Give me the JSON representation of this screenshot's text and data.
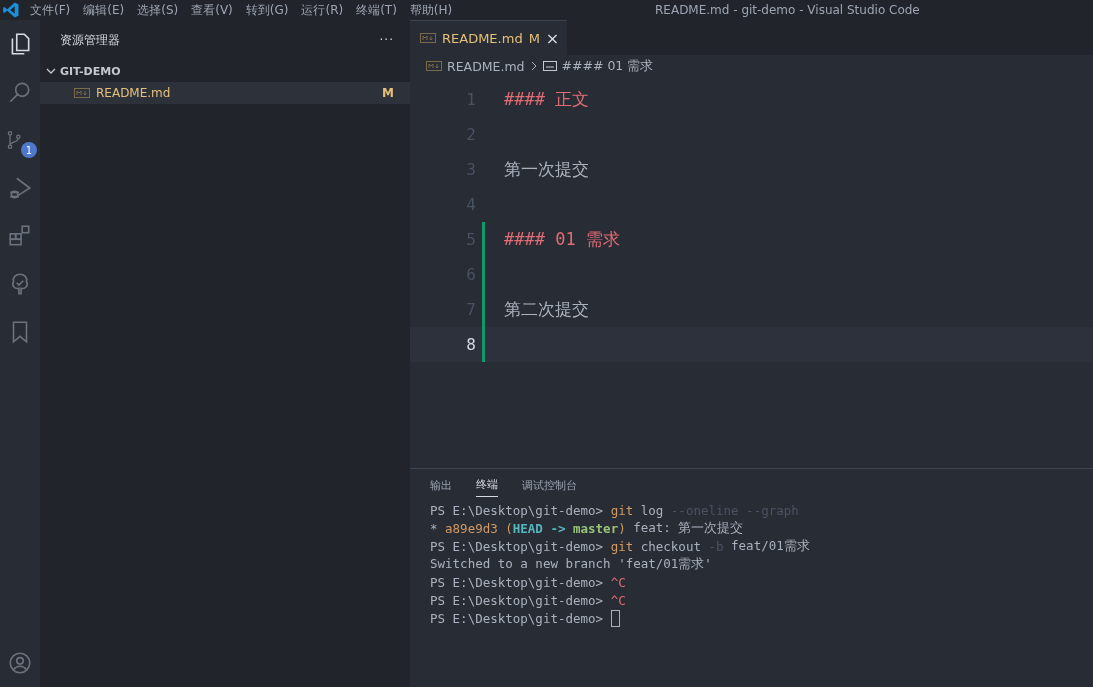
{
  "window": {
    "title": "README.md - git-demo - Visual Studio Code"
  },
  "menu": [
    "文件(F)",
    "编辑(E)",
    "选择(S)",
    "查看(V)",
    "转到(G)",
    "运行(R)",
    "终端(T)",
    "帮助(H)"
  ],
  "activity_bar": [
    {
      "kind": "files",
      "selected": true
    },
    {
      "kind": "search",
      "selected": false
    },
    {
      "kind": "scm",
      "selected": false,
      "badge": "1"
    },
    {
      "kind": "debug",
      "selected": false
    },
    {
      "kind": "extensions",
      "selected": false
    },
    {
      "kind": "tree",
      "selected": false
    },
    {
      "kind": "bookmark",
      "selected": false
    },
    {
      "kind": "account",
      "selected": false
    }
  ],
  "sidebar": {
    "title": "资源管理器",
    "more": "···",
    "folder": {
      "name": "GIT-DEMO",
      "expanded": true,
      "children": [
        {
          "name": "README.md",
          "status": "M",
          "selected": true
        }
      ]
    }
  },
  "tabs": [
    {
      "label": "README.md",
      "status": "M",
      "close": "×",
      "selected": true
    }
  ],
  "breadcrumb": [
    "README.md",
    "#### 01 需求"
  ],
  "editor": {
    "lines": [
      {
        "number": "1",
        "text": "#### 正文",
        "kind": "heading",
        "added": false,
        "current": false
      },
      {
        "number": "2",
        "kind": "empty",
        "added": false,
        "current": false
      },
      {
        "number": "3",
        "text": "第一次提交",
        "kind": "text",
        "added": false,
        "current": false
      },
      {
        "number": "4",
        "kind": "empty",
        "added": false,
        "current": false
      },
      {
        "number": "5",
        "text": "#### 01 需求",
        "kind": "heading",
        "added": true,
        "current": false
      },
      {
        "number": "6",
        "kind": "empty",
        "added": true,
        "current": false
      },
      {
        "number": "7",
        "text": "第二次提交",
        "kind": "text",
        "added": true,
        "current": false
      },
      {
        "number": "8",
        "kind": "empty",
        "added": true,
        "current": true
      }
    ]
  },
  "panel": {
    "tabs": [
      {
        "label": "输出",
        "selected": false
      },
      {
        "label": "终端",
        "selected": true
      },
      {
        "label": "调试控制台",
        "selected": false
      }
    ],
    "terminal": [
      [
        {
          "text": "PS E:\\Desktop\\git-demo> ",
          "kind": "plain"
        },
        {
          "text": "git",
          "kind": "command"
        },
        {
          "text": " log ",
          "kind": "plain"
        },
        {
          "text": "--oneline --graph",
          "kind": "dim"
        }
      ],
      [
        {
          "text": "* ",
          "kind": "plain"
        },
        {
          "text": "a89e9d3 (",
          "kind": "command"
        },
        {
          "text": "HEAD -> ",
          "kind": "head"
        },
        {
          "text": "master",
          "kind": "branch"
        },
        {
          "text": ")",
          "kind": "command"
        },
        {
          "text": " feat: 第一次提交",
          "kind": "plain"
        }
      ],
      [
        {
          "text": "PS E:\\Desktop\\git-demo> ",
          "kind": "plain"
        },
        {
          "text": "git",
          "kind": "command"
        },
        {
          "text": " checkout ",
          "kind": "plain"
        },
        {
          "text": "-b",
          "kind": "dim"
        },
        {
          "text": " feat/01需求",
          "kind": "plain"
        }
      ],
      [
        {
          "text": "Switched to a new branch 'feat/01需求'",
          "kind": "plain"
        }
      ],
      [
        {
          "text": "PS E:\\Desktop\\git-demo> ",
          "kind": "plain"
        },
        {
          "text": "^C",
          "kind": "error"
        }
      ],
      [
        {
          "text": "PS E:\\Desktop\\git-demo> ",
          "kind": "plain"
        },
        {
          "text": "^C",
          "kind": "error"
        }
      ],
      [
        {
          "text": "PS E:\\Desktop\\git-demo> ",
          "kind": "plain"
        }
      ]
    ],
    "cursor": true
  }
}
